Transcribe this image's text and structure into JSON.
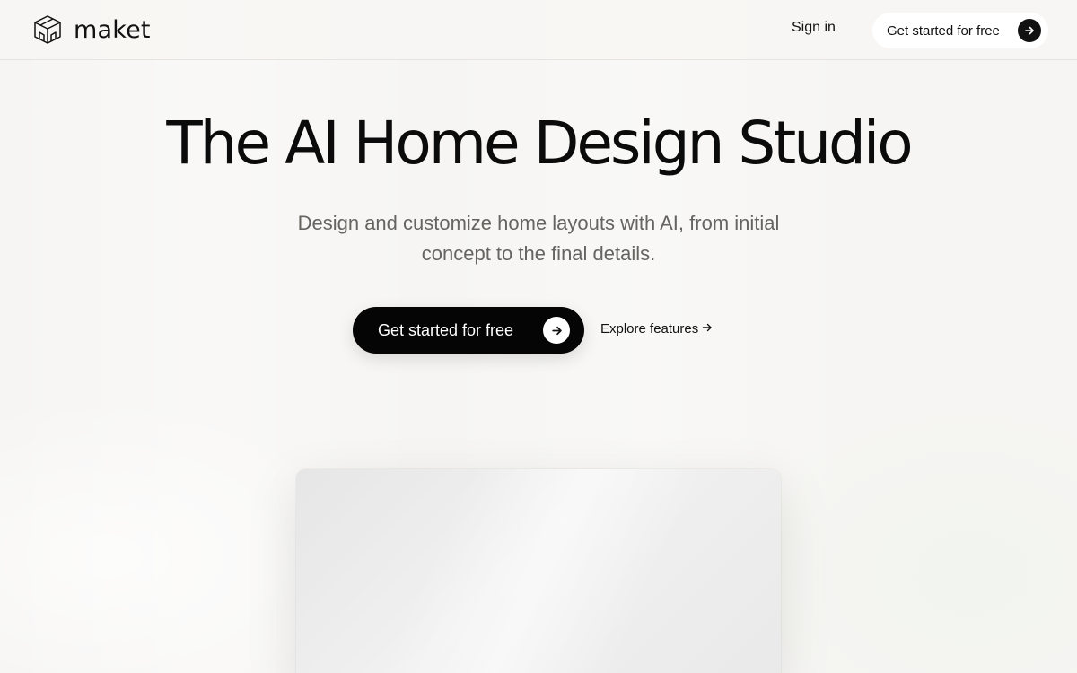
{
  "header": {
    "brand": "maket",
    "logo_icon": "cube-house-icon",
    "signin_label": "Sign in",
    "cta_label": "Get started for free",
    "cta_icon": "arrow-right-icon"
  },
  "hero": {
    "title": "The AI Home Design Studio",
    "subtitle": "Design and customize home layouts with AI, from initial concept to the final details.",
    "primary_cta_label": "Get started for free",
    "primary_cta_icon": "arrow-right-icon",
    "secondary_cta_label": "Explore features",
    "secondary_cta_icon": "arrow-right-icon"
  },
  "colors": {
    "background": "#f6f5f3",
    "primary_button": "#050505",
    "text": "#111111",
    "muted_text": "#666460"
  }
}
